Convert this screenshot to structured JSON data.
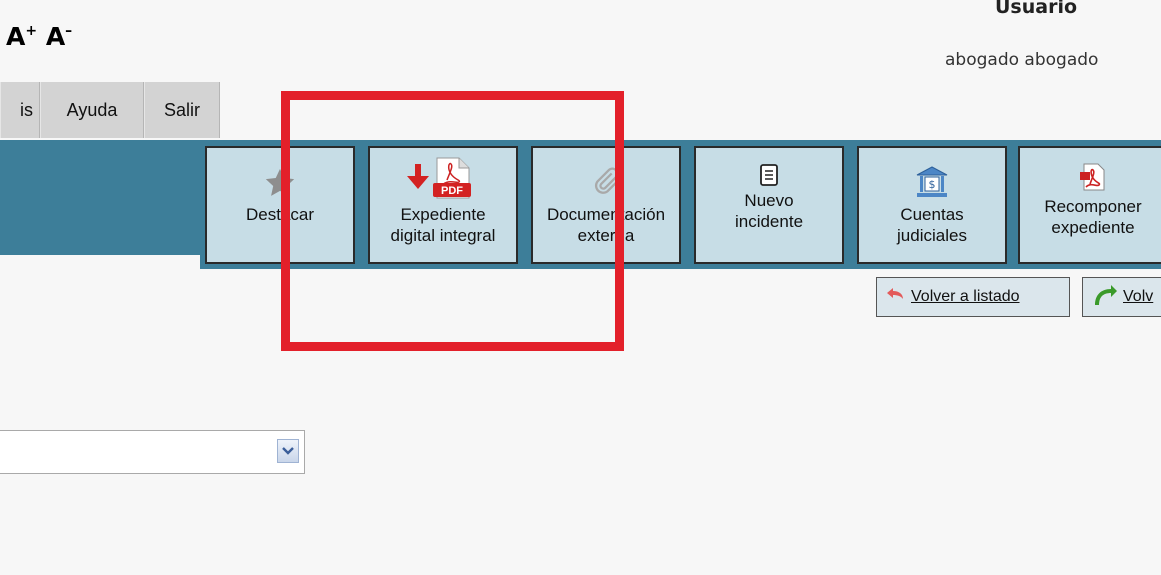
{
  "header": {
    "font_increase": "A",
    "font_increase_sign": "+",
    "font_decrease": "A",
    "font_decrease_sign": "–",
    "user_heading": "Usuario",
    "user_name": "abogado abogado"
  },
  "menu": {
    "tabs": [
      {
        "label": "is"
      },
      {
        "label": "Ayuda"
      },
      {
        "label": "Salir"
      }
    ]
  },
  "toolbar": {
    "buttons": [
      {
        "label": "Destacar",
        "icon": "star-icon"
      },
      {
        "label": "Expediente\ndigital integral",
        "icon": "pdf-download-icon"
      },
      {
        "label": "Documentación\nexterna",
        "icon": "paperclip-icon"
      },
      {
        "label": "Nuevo\nincidente",
        "icon": "document-icon"
      },
      {
        "label": "Cuentas\njudiciales",
        "icon": "bank-icon"
      },
      {
        "label": "Recomponer\nexpediente",
        "icon": "pdf-file-icon"
      }
    ],
    "secondary": [
      {
        "label": "Volver a listado",
        "icon": "return-arrow-icon"
      },
      {
        "label": "Volv",
        "icon": "up-arrow-icon"
      }
    ]
  },
  "form": {
    "select_value": ""
  },
  "colors": {
    "toolbar_band": "#3d7e99",
    "button_bg": "#c7dde6",
    "highlight": "#e3202a",
    "tab_bg": "#d3d3d3"
  }
}
